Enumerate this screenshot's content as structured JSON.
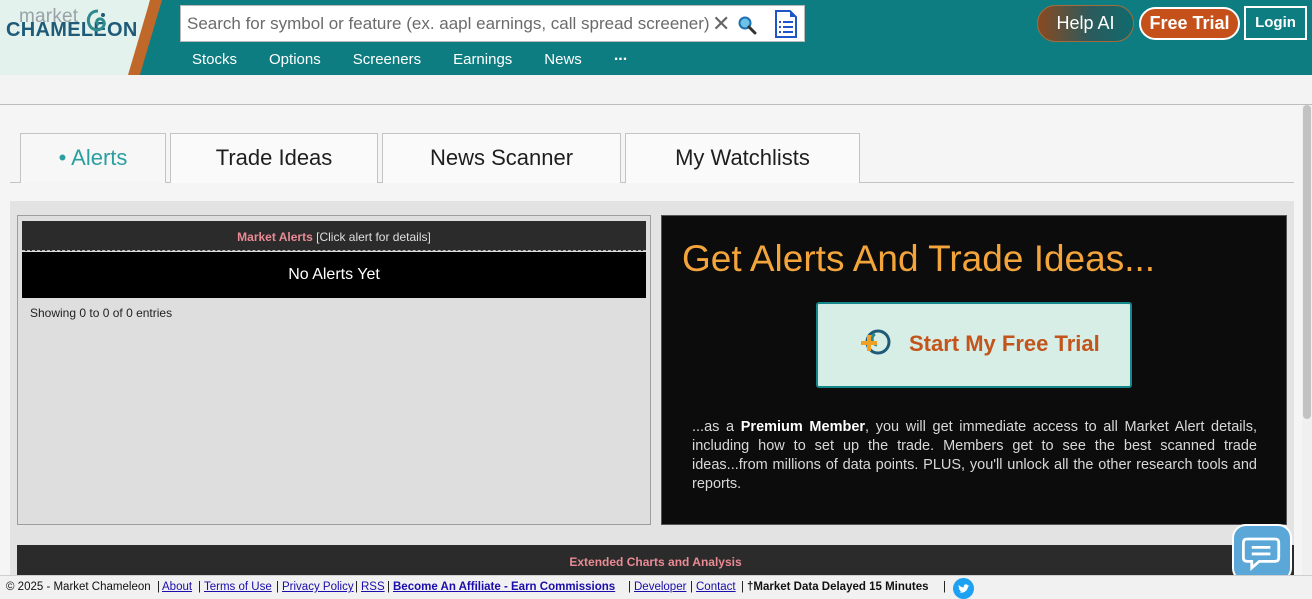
{
  "header": {
    "logo_top": "market",
    "logo_main": "CHAMELEON",
    "search_placeholder": "Search for symbol or feature (ex. aapl earnings, call spread screener)",
    "clear_symbol": "✕",
    "help_ai_label": "Help AI",
    "free_trial_label": "Free Trial",
    "login_label": "Login",
    "accent_color": "#0e7d82",
    "trial_color": "#c6501a"
  },
  "nav": {
    "items": [
      "Stocks",
      "Options",
      "Screeners",
      "Earnings",
      "News"
    ],
    "more": "..."
  },
  "tabs": [
    {
      "label": "• Alerts",
      "active": true
    },
    {
      "label": "Trade Ideas",
      "active": false
    },
    {
      "label": "News Scanner",
      "active": false
    },
    {
      "label": "My Watchlists",
      "active": false
    }
  ],
  "alerts": {
    "title": "Market Alerts",
    "hint": "[Click alert for details]",
    "empty": "No Alerts Yet",
    "showing": "Showing 0 to 0 of 0 entries"
  },
  "promo": {
    "title": "Get Alerts And Trade Ideas...",
    "button": "Start My Free Trial",
    "text_pre": "...as a ",
    "text_bold": "Premium Member",
    "text_post": ", you will get immediate access to all Market Alert details, including how to set up the trade. Members get to see the best scanned trade ideas...from millions of data points. PLUS, you'll unlock all the other research tools and reports."
  },
  "extended": {
    "title": "Extended Charts and Analysis"
  },
  "footer": {
    "copyright": "© 2025 - Market Chameleon",
    "about": "About",
    "terms": "Terms of Use",
    "privacy": "Privacy Policy",
    "rss": "RSS",
    "affiliate": "Become An Affiliate - Earn Commissions",
    "developer": "Developer",
    "contact": "Contact",
    "delayed": "†Market Data Delayed 15 Minutes"
  }
}
